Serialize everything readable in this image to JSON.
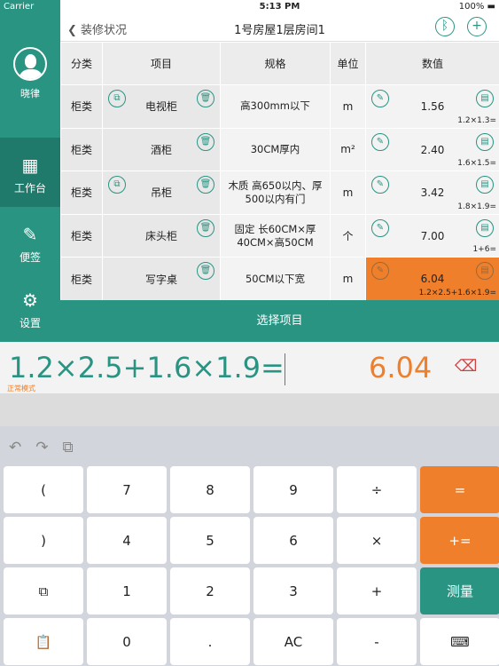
{
  "status": {
    "carrier": "Carrier",
    "time": "5:13 PM",
    "battery": "100%"
  },
  "sidebar": {
    "user": "晓律",
    "items": [
      {
        "label": "工作台",
        "icon": "calendar-icon",
        "selected": true
      },
      {
        "label": "便签",
        "icon": "note-edit-icon"
      },
      {
        "label": "设置",
        "icon": "gear-icon"
      }
    ]
  },
  "nav": {
    "back": "装修状况",
    "title": "1号房屋1层房间1"
  },
  "table": {
    "headers": [
      "分类",
      "项目",
      "规格",
      "单位",
      "数值"
    ],
    "rows": [
      {
        "cat": "柜类",
        "item": "电视柜",
        "spec": "高300mm以下",
        "unit": "m",
        "value": "1.56",
        "expr": "1.2×1.3=",
        "copy": true
      },
      {
        "cat": "柜类",
        "item": "酒柜",
        "spec": "30CM厚内",
        "unit": "m²",
        "value": "2.40",
        "expr": "1.6×1.5=",
        "copy": false
      },
      {
        "cat": "柜类",
        "item": "吊柜",
        "spec": "木质 高650以内、厚500以内有门",
        "unit": "m",
        "value": "3.42",
        "expr": "1.8×1.9=",
        "copy": true
      },
      {
        "cat": "柜类",
        "item": "床头柜",
        "spec": "固定 长60CM×厚40CM×高50CM",
        "unit": "个",
        "value": "7.00",
        "expr": "1+6=",
        "copy": false
      },
      {
        "cat": "柜类",
        "item": "写字桌",
        "spec": "50CM以下宽",
        "unit": "m",
        "value": "6.04",
        "expr": "1.2×2.5+1.6×1.9=",
        "copy": false,
        "highlight": true
      }
    ]
  },
  "select_label": "选择项目",
  "calc": {
    "expression": "1.2×2.5+1.6×1.9=",
    "result": "6.04",
    "mode": "正常模式"
  },
  "keys": [
    "(",
    "7",
    "8",
    "9",
    "÷",
    "=",
    ")",
    "4",
    "5",
    "6",
    "×",
    "+=",
    "⧉",
    "1",
    "2",
    "3",
    "+",
    "测量",
    "📋",
    "0",
    ".",
    "AC",
    "-",
    "⌨"
  ],
  "colors": {
    "accent": "#2a9483",
    "highlight": "#ef7f2a"
  }
}
